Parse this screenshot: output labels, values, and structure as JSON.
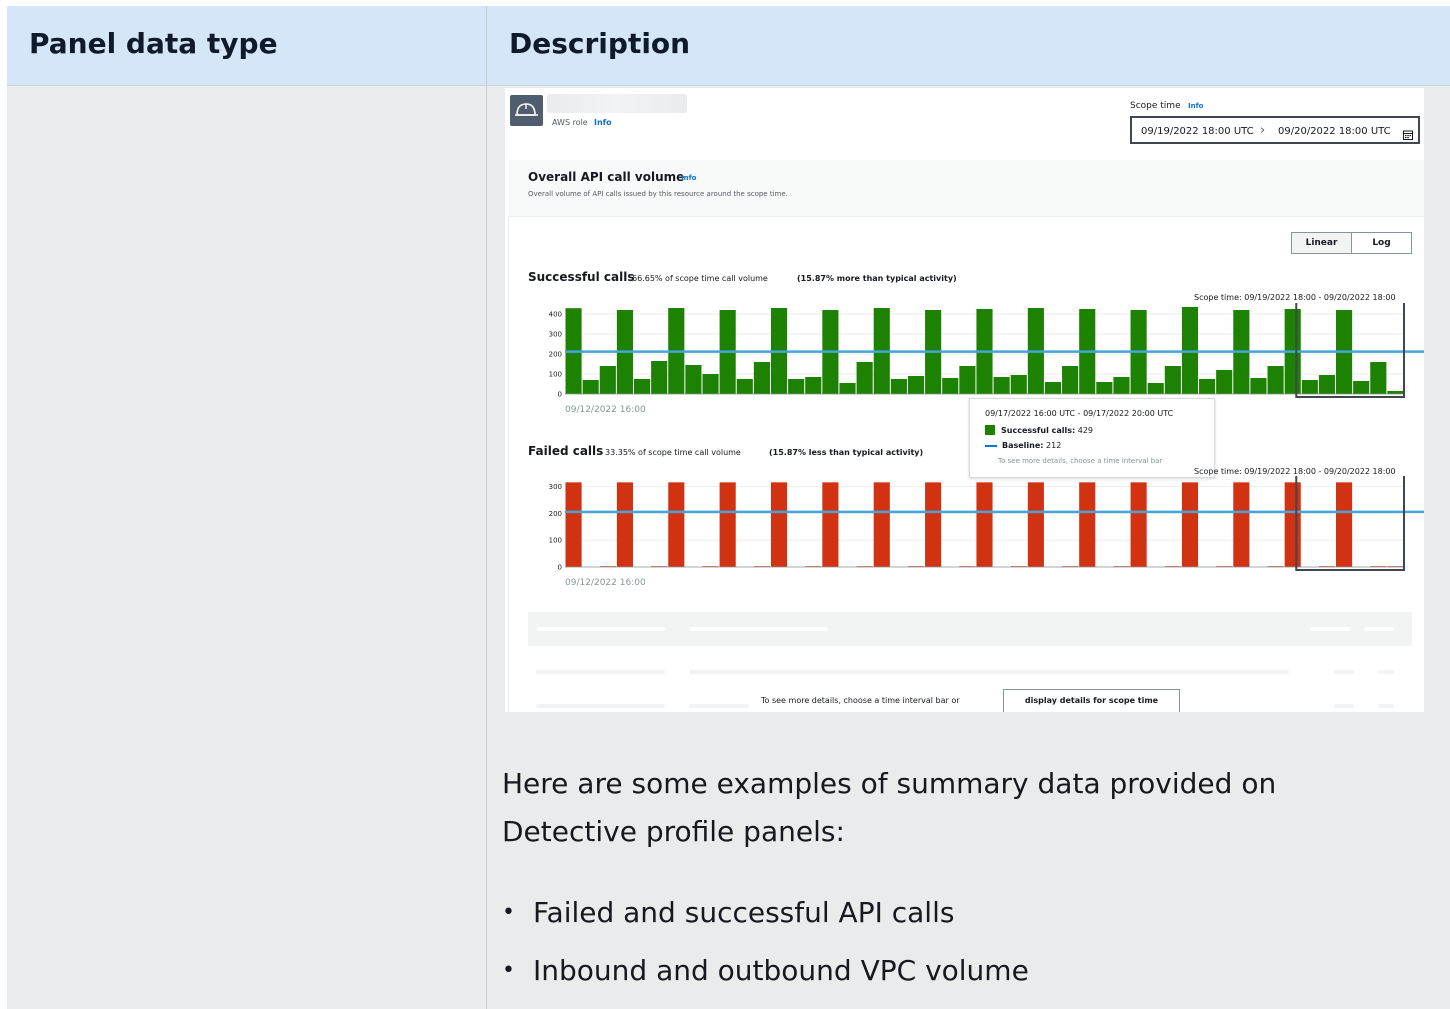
{
  "table": {
    "header": {
      "col1": "Panel data type",
      "col2": "Description"
    }
  },
  "screenshot": {
    "role": {
      "label": "AWS role",
      "info": "Info"
    },
    "scope_time": {
      "label": "Scope time",
      "info": "Info",
      "start": "09/19/2022 18:00 UTC",
      "end": "09/20/2022 18:00 UTC"
    },
    "panel": {
      "title": "Overall API call volume",
      "info": "Info",
      "description": "Overall volume of API calls issued by this resource around the scope time.",
      "scale_options": [
        "Linear",
        "Log"
      ],
      "selected_scale": "Linear"
    },
    "successful": {
      "title": "Successful calls",
      "pct_text": "66.65% of scope time call volume",
      "note": "(15.87% more than typical activity)",
      "scope_caption": "Scope time: 09/19/2022 18:00 - 09/20/2022 18:00",
      "start_label": "09/12/2022 16:00"
    },
    "failed": {
      "title": "Failed calls",
      "pct_text": "33.35% of scope time call volume",
      "note": "(15.87% less than typical activity)",
      "scope_caption": "Scope time: 09/19/2022 18:00 - 09/20/2022 18:00",
      "start_label": "09/12/2022 16:00"
    },
    "tooltip": {
      "range": "09/17/2022 16:00 UTC - 09/17/2022 20:00 UTC",
      "successful_label": "Successful calls:",
      "successful_value": "429",
      "baseline_label": "Baseline:",
      "baseline_value": "212",
      "hint": "To see more details, choose a time interval bar"
    },
    "bottom": {
      "text": "To see more details, choose a time interval bar or",
      "button": "display details for scope time"
    },
    "colors": {
      "success": "#1d8102",
      "failed": "#d13212",
      "baseline": "#44a5da",
      "scope_box": "#414750"
    }
  },
  "summary": {
    "intro": "Here are some examples of summary data provided on Detective profile panels:",
    "bullets": [
      "Failed and successful API calls",
      "Inbound and outbound VPC volume"
    ]
  },
  "chart_data": [
    {
      "type": "bar",
      "title": "Successful calls",
      "x_start_label": "09/12/2022 16:00",
      "yticks": [
        0,
        100,
        200,
        300,
        400
      ],
      "ylim": [
        0,
        430
      ],
      "baseline": 212,
      "values": [
        429,
        70,
        140,
        420,
        75,
        165,
        430,
        145,
        100,
        420,
        75,
        160,
        430,
        75,
        85,
        420,
        55,
        160,
        430,
        75,
        90,
        420,
        80,
        140,
        425,
        85,
        95,
        430,
        60,
        140,
        425,
        60,
        85,
        420,
        55,
        140,
        435,
        75,
        120,
        420,
        80,
        140,
        425,
        70,
        95,
        420,
        65,
        160,
        15
      ]
    },
    {
      "type": "bar",
      "title": "Failed calls",
      "x_start_label": "09/12/2022 16:00",
      "yticks": [
        0,
        100,
        200,
        300
      ],
      "ylim": [
        0,
        320
      ],
      "baseline": 205,
      "values": [
        315,
        0,
        3,
        315,
        0,
        3,
        315,
        0,
        3,
        315,
        0,
        3,
        315,
        0,
        3,
        315,
        0,
        3,
        315,
        0,
        3,
        315,
        0,
        3,
        315,
        0,
        3,
        315,
        0,
        3,
        315,
        0,
        3,
        315,
        0,
        3,
        315,
        0,
        3,
        315,
        0,
        3,
        315,
        0,
        3,
        315,
        0,
        3,
        3
      ]
    }
  ]
}
